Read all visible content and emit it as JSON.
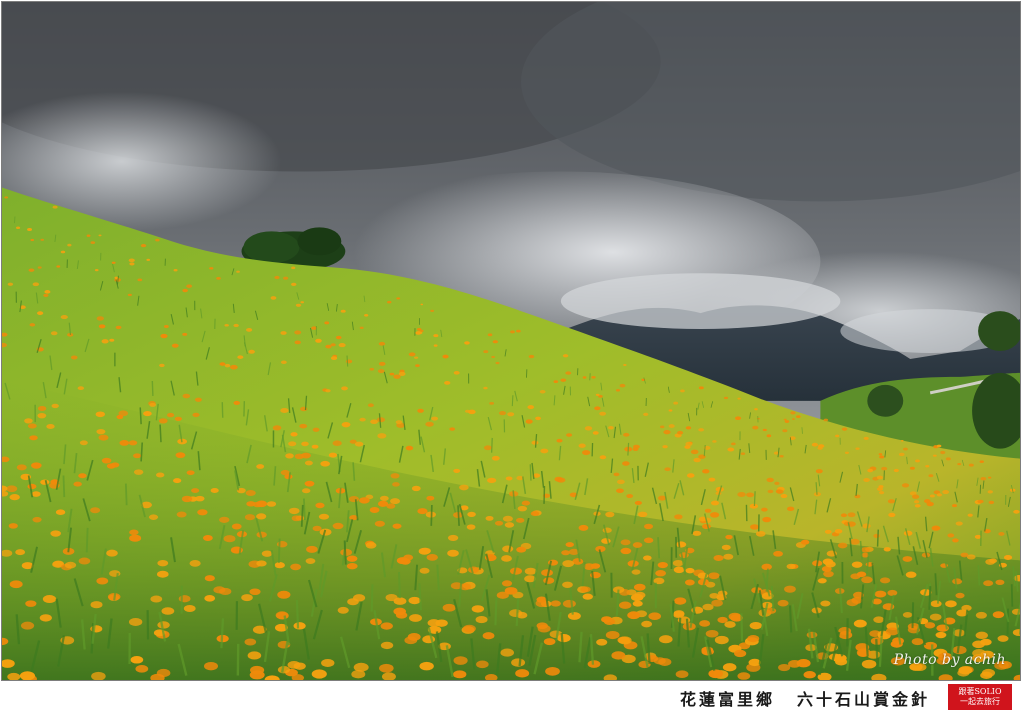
{
  "photo": {
    "subject": "daylily-field-hillside",
    "colors": {
      "sky_top": "#4a4d52",
      "sky_mid": "#6f7378",
      "cloud_light": "#d9dbde",
      "mountain": "#2e3a45",
      "grass_dark": "#3f7a22",
      "grass_light": "#8fbf2e",
      "flower": "#f5a10f"
    }
  },
  "watermark": {
    "text": "Photo by achih"
  },
  "caption": {
    "location": "花蓮富里鄉",
    "title": "六十石山賞金針"
  },
  "stamp": {
    "line1": "跟著SOLIO",
    "line2": "一起去旅行"
  }
}
